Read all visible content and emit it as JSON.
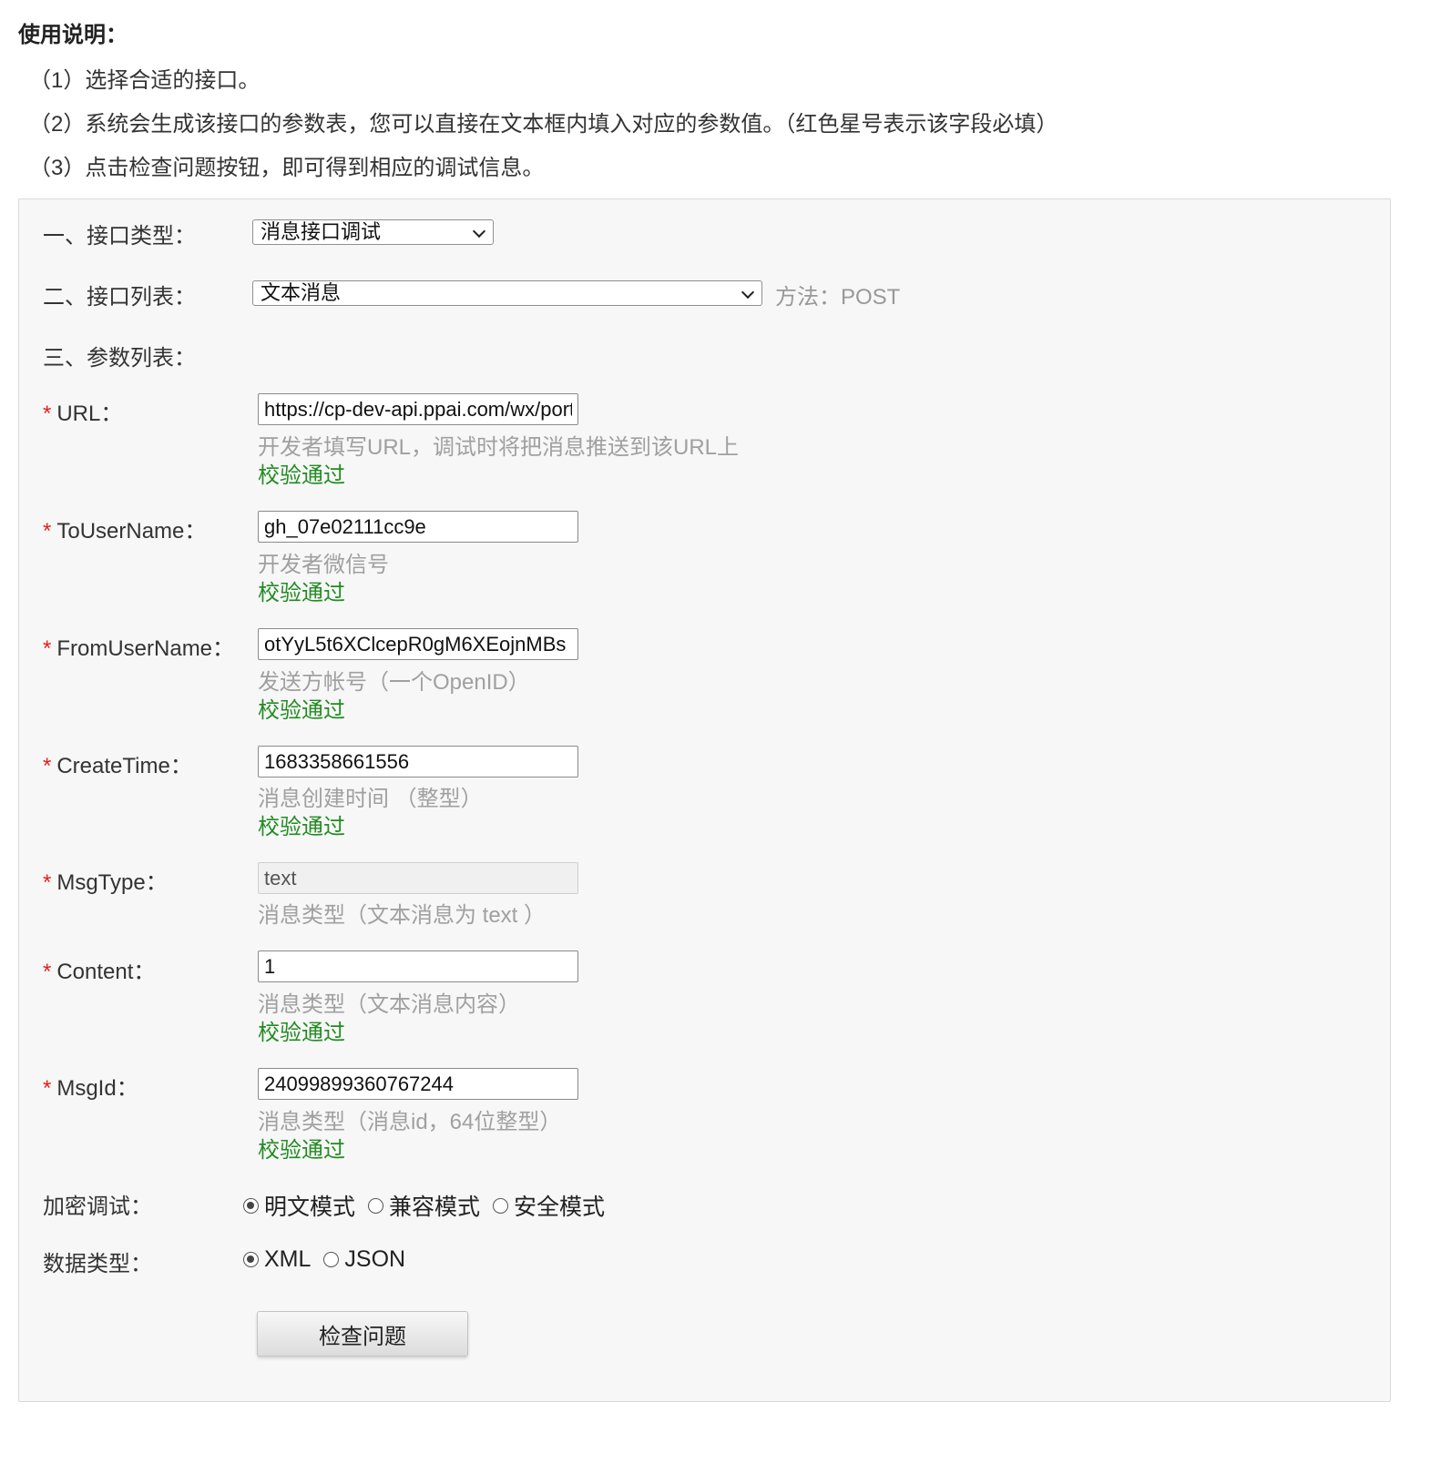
{
  "instructions": {
    "title": "使用说明：",
    "lines": [
      "（1）选择合适的接口。",
      "（2）系统会生成该接口的参数表，您可以直接在文本框内填入对应的参数值。（红色星号表示该字段必填）",
      "（3）点击检查问题按钮，即可得到相应的调试信息。"
    ]
  },
  "form": {
    "interface_type": {
      "label": "一、接口类型：",
      "selected": "消息接口调试"
    },
    "interface_list": {
      "label": "二、接口列表：",
      "selected": "文本消息",
      "method": "方法：POST"
    },
    "params_label": "三、参数列表：",
    "required_mark": "*",
    "fields": [
      {
        "label": "URL：",
        "value": "https://cp-dev-api.ppai.com/wx/portal",
        "hint": "开发者填写URL，调试时将把消息推送到该URL上",
        "status": "校验通过"
      },
      {
        "label": "ToUserName：",
        "value": "gh_07e02111cc9e",
        "hint": "开发者微信号",
        "status": "校验通过"
      },
      {
        "label": "FromUserName：",
        "value": "otYyL5t6XClcepR0gM6XEojnMBs",
        "hint": "发送方帐号（一个OpenID）",
        "status": "校验通过"
      },
      {
        "label": "CreateTime：",
        "value": "1683358661556",
        "hint": "消息创建时间 （整型）",
        "status": "校验通过"
      },
      {
        "label": "MsgType：",
        "value": "text",
        "hint": "消息类型（文本消息为 text ）",
        "status": ""
      },
      {
        "label": "Content：",
        "value": "1",
        "hint": "消息类型（文本消息内容）",
        "status": "校验通过"
      },
      {
        "label": "MsgId：",
        "value": "24099899360767244",
        "hint": "消息类型（消息id，64位整型）",
        "status": "校验通过"
      }
    ],
    "encrypt": {
      "label": "加密调试：",
      "options": [
        "明文模式",
        "兼容模式",
        "安全模式"
      ],
      "selected": "明文模式"
    },
    "data_type": {
      "label": "数据类型：",
      "options": [
        "XML",
        "JSON"
      ],
      "selected": "XML"
    },
    "submit_label": "检查问题"
  },
  "colors": {
    "required": "#e02020",
    "success": "#228b22",
    "hint": "#a0a0a0",
    "panel_bg": "#f7f7f7"
  }
}
